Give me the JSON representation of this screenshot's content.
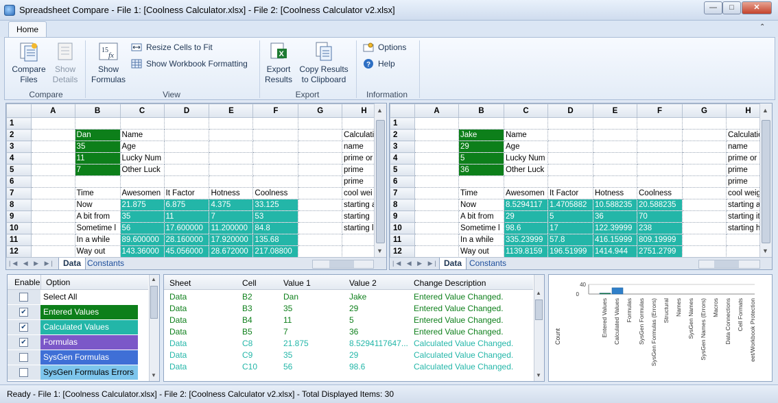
{
  "window": {
    "title": "Spreadsheet Compare - File 1: [Coolness Calculator.xlsx] - File 2: [Coolness Calculator v2.xlsx]"
  },
  "ribbon": {
    "tab": "Home",
    "groups": {
      "compare": "Compare",
      "view": "View",
      "export": "Export",
      "information": "Information"
    },
    "buttons": {
      "compare_files": [
        "Compare",
        "Files"
      ],
      "show_details": [
        "Show",
        "Details"
      ],
      "show_formulas": [
        "Show",
        "Formulas"
      ],
      "resize_cells": "Resize Cells to Fit",
      "show_workbook_formatting": "Show Workbook Formatting",
      "export_results": [
        "Export",
        "Results"
      ],
      "copy_results": [
        "Copy Results",
        "to Clipboard"
      ],
      "options": "Options",
      "help": "Help"
    }
  },
  "grid_left": {
    "columns": [
      "A",
      "B",
      "C",
      "D",
      "E",
      "F",
      "G",
      "H"
    ],
    "rows": [
      [
        "1",
        "",
        "",
        "",
        "",
        "",
        "",
        "",
        ""
      ],
      [
        "2",
        "",
        "Dan",
        "Name",
        "",
        "",
        "",
        "",
        "Calculati"
      ],
      [
        "3",
        "",
        "35",
        "Age",
        "",
        "",
        "",
        "",
        "name"
      ],
      [
        "4",
        "",
        "11",
        "Lucky Num",
        "",
        "",
        "",
        "",
        "prime or"
      ],
      [
        "5",
        "",
        "7",
        "Other Luck",
        "",
        "",
        "",
        "",
        "prime"
      ],
      [
        "6",
        "",
        "",
        "",
        "",
        "",
        "",
        "",
        "prime"
      ],
      [
        "7",
        "",
        "Time",
        "Awesomen",
        "It Factor",
        "Hotness",
        "Coolness",
        "",
        "cool wei"
      ],
      [
        "8",
        "",
        "Now",
        "21.875",
        "6.875",
        "4.375",
        "33.125",
        "",
        "starting a"
      ],
      [
        "9",
        "",
        "A bit from",
        "35",
        "11",
        "7",
        "53",
        "",
        "starting"
      ],
      [
        "10",
        "",
        "Sometime l",
        "56",
        "17.600000",
        "11.200000",
        "84.8",
        "",
        "starting l"
      ],
      [
        "11",
        "",
        "In a while",
        "89.600000",
        "28.160000",
        "17.920000",
        "135.68",
        "",
        ""
      ],
      [
        "12",
        "",
        "Way out",
        "143.36000",
        "45.056000",
        "28.672000",
        "217.08800",
        "",
        ""
      ]
    ]
  },
  "grid_right": {
    "columns": [
      "A",
      "B",
      "C",
      "D",
      "E",
      "F",
      "G",
      "H"
    ],
    "rows": [
      [
        "1",
        "",
        "",
        "",
        "",
        "",
        "",
        "",
        ""
      ],
      [
        "2",
        "",
        "Jake",
        "Name",
        "",
        "",
        "",
        "",
        "Calculatio"
      ],
      [
        "3",
        "",
        "29",
        "Age",
        "",
        "",
        "",
        "",
        "name"
      ],
      [
        "4",
        "",
        "5",
        "Lucky Num",
        "",
        "",
        "",
        "",
        "prime or a"
      ],
      [
        "5",
        "",
        "36",
        "Other Luck",
        "",
        "",
        "",
        "",
        "prime"
      ],
      [
        "6",
        "",
        "",
        "",
        "",
        "",
        "",
        "",
        "prime"
      ],
      [
        "7",
        "",
        "Time",
        "Awesomen",
        "It Factor",
        "Hotness",
        "Coolness",
        "",
        "cool weig"
      ],
      [
        "8",
        "",
        "Now",
        "8.5294117",
        "1.4705882",
        "10.588235",
        "20.588235",
        "",
        "starting a"
      ],
      [
        "9",
        "",
        "A bit from",
        "29",
        "5",
        "36",
        "70",
        "",
        "starting it"
      ],
      [
        "10",
        "",
        "Sometime l",
        "98.6",
        "17",
        "122.39999",
        "238",
        "",
        "starting h"
      ],
      [
        "11",
        "",
        "In a while",
        "335.23999",
        "57.8",
        "416.15999",
        "809.19999",
        "",
        ""
      ],
      [
        "12",
        "",
        "Way out",
        "1139.8159",
        "196.51999",
        "1414.944",
        "2751.2799",
        "",
        ""
      ]
    ]
  },
  "sheet_tabs": [
    "Data",
    "Constants"
  ],
  "options_panel": {
    "headers": [
      "Enable",
      "Option"
    ],
    "items": [
      {
        "label": "Select All",
        "checked": false,
        "color": "#ffffff",
        "text_color": "#000000"
      },
      {
        "label": "Entered Values",
        "checked": true,
        "color": "#0d7f1a",
        "text_color": "#ffffff"
      },
      {
        "label": "Calculated Values",
        "checked": true,
        "color": "#23b6a8",
        "text_color": "#ffffff"
      },
      {
        "label": "Formulas",
        "checked": true,
        "color": "#7b58c8",
        "text_color": "#ffffff"
      },
      {
        "label": "SysGen Formulas",
        "checked": false,
        "color": "#3f6fd6",
        "text_color": "#ffffff"
      },
      {
        "label": "SysGen Formulas Errors",
        "checked": false,
        "color": "#7dc5ec",
        "text_color": "#000000"
      }
    ]
  },
  "changes_panel": {
    "headers": [
      "Sheet",
      "Cell",
      "Value 1",
      "Value 2",
      "Change Description"
    ],
    "rows": [
      {
        "sheet": "Data",
        "cell": "B2",
        "v1": "Dan",
        "v2": "Jake",
        "desc": "Entered Value Changed.",
        "kind": "entered"
      },
      {
        "sheet": "Data",
        "cell": "B3",
        "v1": "35",
        "v2": "29",
        "desc": "Entered Value Changed.",
        "kind": "entered"
      },
      {
        "sheet": "Data",
        "cell": "B4",
        "v1": "11",
        "v2": "5",
        "desc": "Entered Value Changed.",
        "kind": "entered"
      },
      {
        "sheet": "Data",
        "cell": "B5",
        "v1": "7",
        "v2": "36",
        "desc": "Entered Value Changed.",
        "kind": "entered"
      },
      {
        "sheet": "Data",
        "cell": "C8",
        "v1": "21.875",
        "v2": "8.5294117647...",
        "desc": "Calculated Value Changed.",
        "kind": "calculated"
      },
      {
        "sheet": "Data",
        "cell": "C9",
        "v1": "35",
        "v2": "29",
        "desc": "Calculated Value Changed.",
        "kind": "calculated"
      },
      {
        "sheet": "Data",
        "cell": "C10",
        "v1": "56",
        "v2": "98.6",
        "desc": "Calculated Value Changed.",
        "kind": "calculated"
      }
    ],
    "colors": {
      "entered": "#0d7f1a",
      "calculated": "#23b6a8"
    }
  },
  "chart_data": {
    "type": "bar",
    "categories": [
      "Entered Values",
      "Calculated Values",
      "Formulas",
      "SysGen Formulas",
      "SysGen Formulas (Errors)",
      "Structural",
      "Names",
      "SysGen Names",
      "SysGen Names (Errors)",
      "Macros",
      "Data Connections",
      "Cell Formats",
      "eet/Workbook Protection"
    ],
    "values": [
      4,
      26,
      0,
      0,
      0,
      0,
      0,
      0,
      0,
      0,
      0,
      0,
      0
    ],
    "ylabel": "Count",
    "yticks": [
      "0",
      "40"
    ],
    "ylim": [
      0,
      40
    ],
    "colors": [
      "#0d7f1a",
      "#2f7fc9"
    ]
  },
  "status": "Ready - File 1: [Coolness Calculator.xlsx] - File 2: [Coolness Calculator v2.xlsx] - Total Displayed Items: 30"
}
